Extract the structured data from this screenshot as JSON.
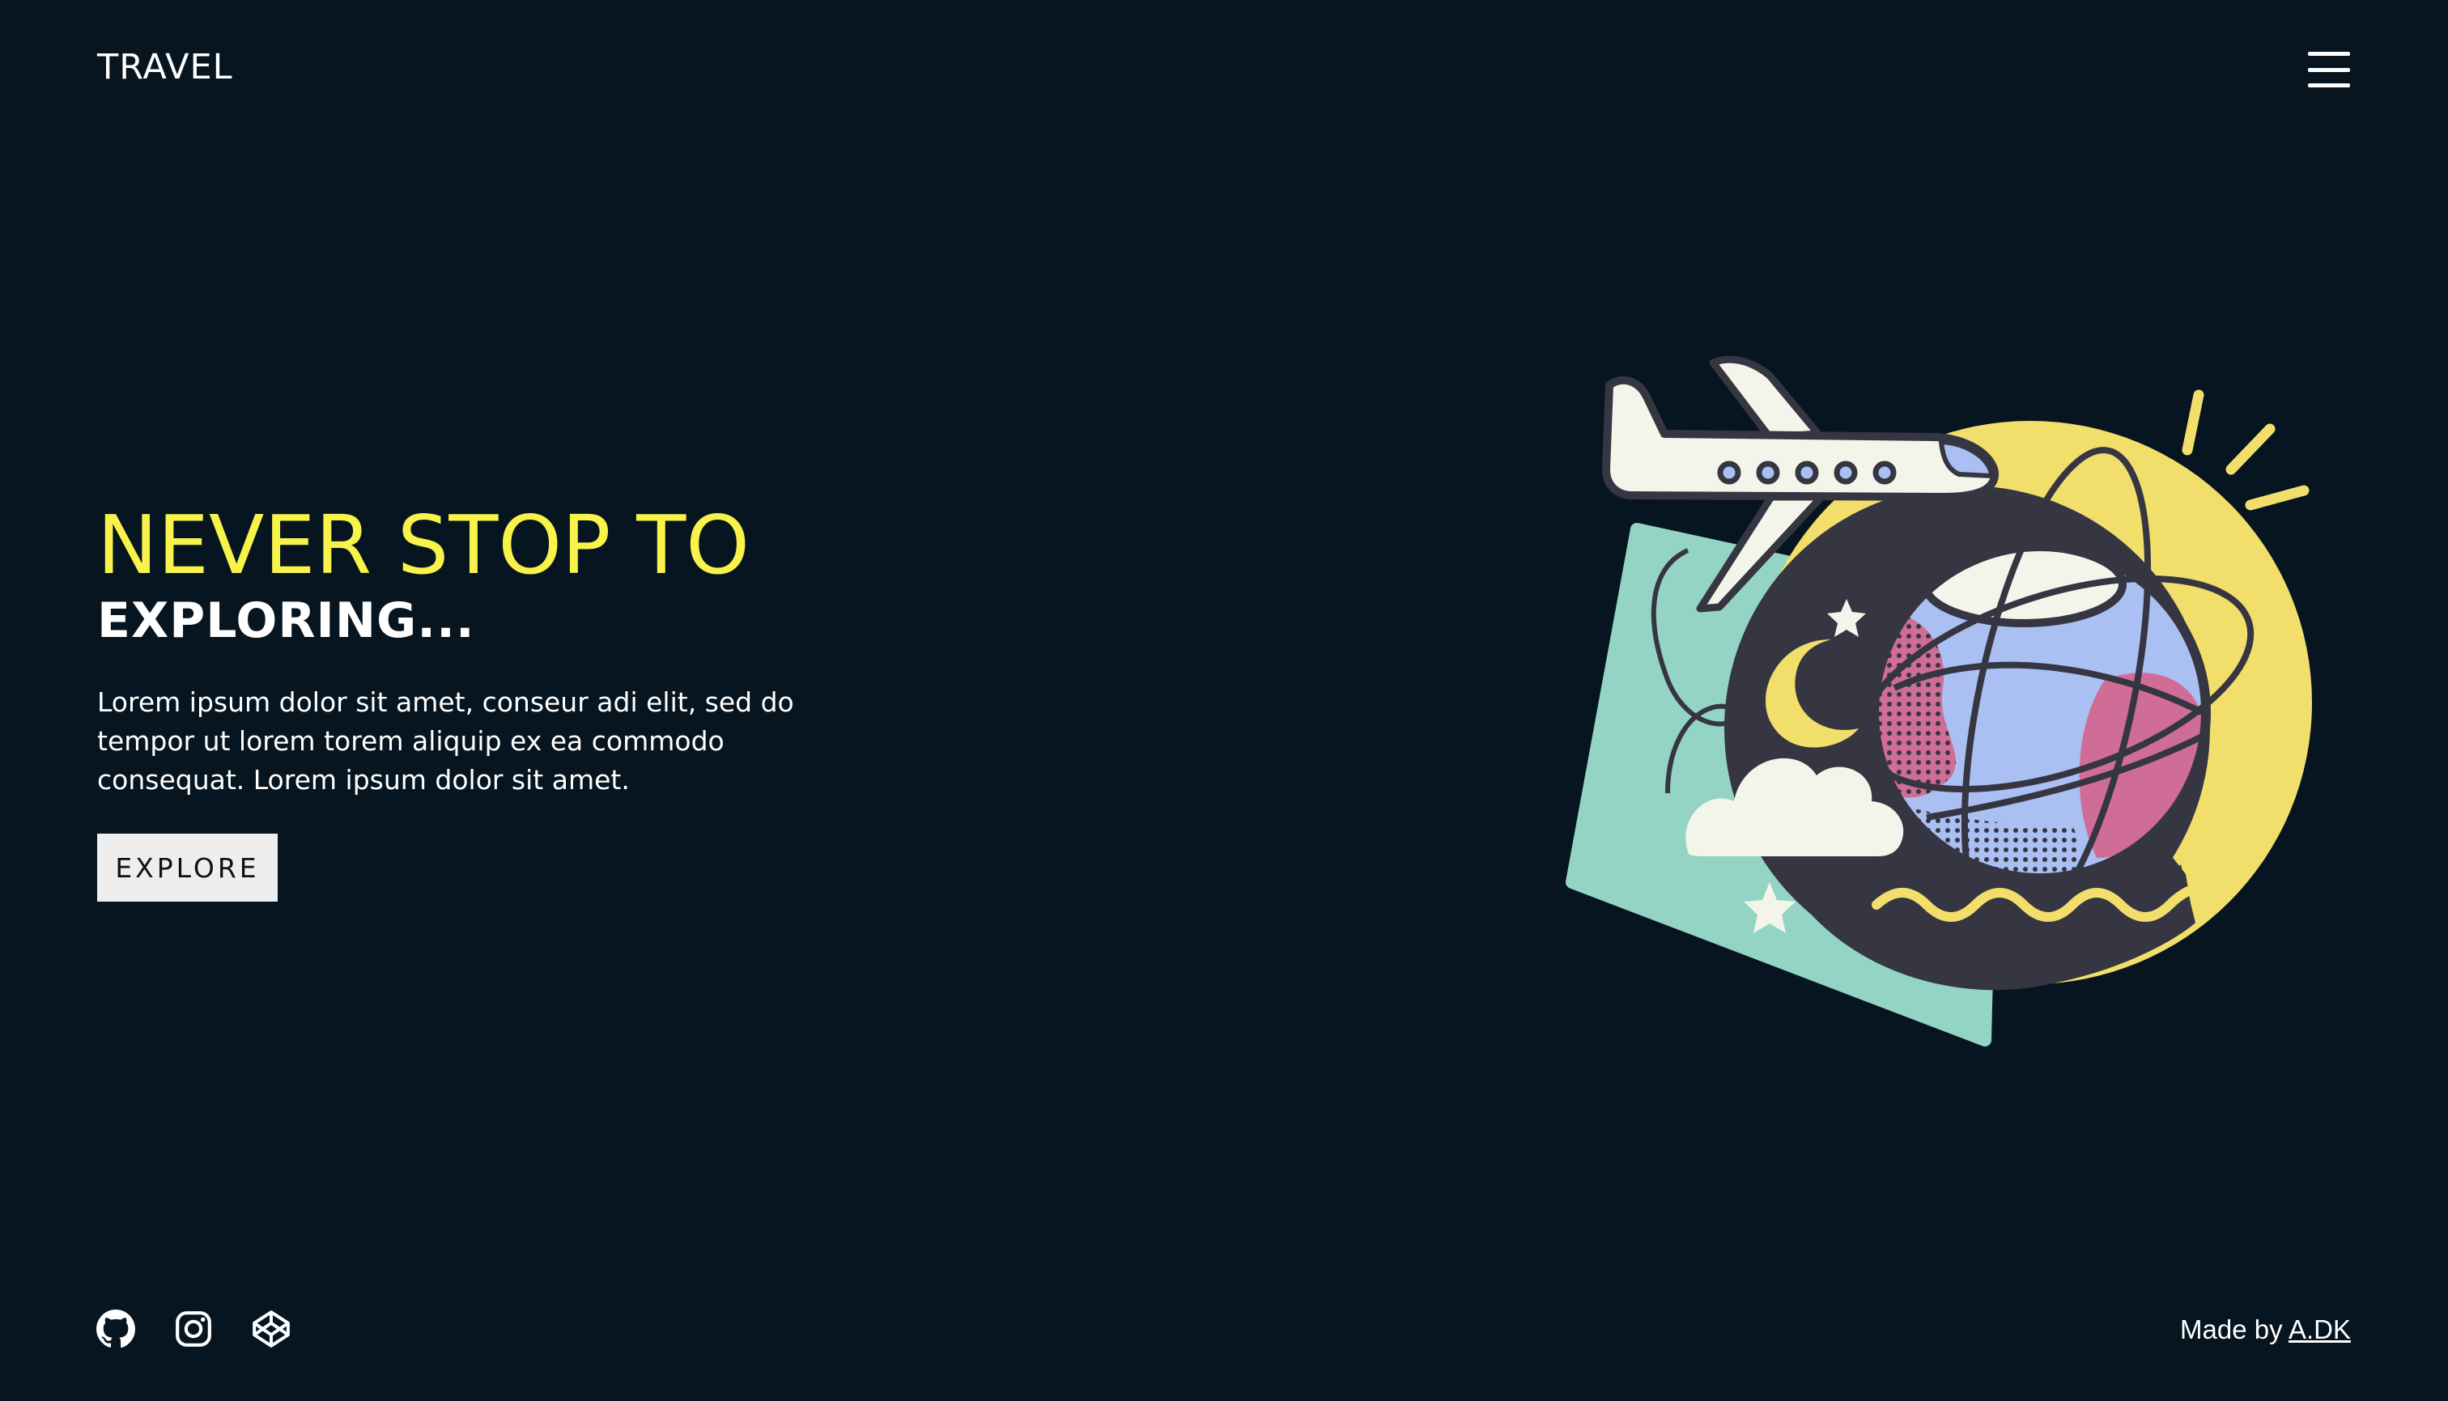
{
  "header": {
    "brand": "TRAVEL",
    "menu_icon": "hamburger-menu-icon"
  },
  "hero": {
    "headline": "NEVER STOP TO",
    "subheadline": "EXPLORING...",
    "description": "Lorem ipsum dolor sit amet, conseur adi elit, sed do tempor ut lorem torem aliquip ex ea commodo consequat. Lorem ipsum dolor sit amet.",
    "cta_label": "EXPLORE"
  },
  "illustration": {
    "name": "travel-globe-illustration",
    "elements": [
      "airplane",
      "globe",
      "moon",
      "stars",
      "cloud",
      "sun-rays",
      "wave"
    ]
  },
  "footer": {
    "social_icons": [
      "github-icon",
      "instagram-icon",
      "codepen-icon"
    ],
    "credit_prefix": "Made by ",
    "credit_link": "A.DK"
  },
  "colors": {
    "background": "#061520",
    "accent_yellow": "#f7f34a",
    "button_bg": "#eeeeee",
    "illustration_mint": "#93d4c4",
    "illustration_sun": "#f2de6a",
    "illustration_dark": "#363643",
    "illustration_blue": "#aabff2",
    "illustration_pink": "#d06d96",
    "illustration_cream": "#f4f5ea"
  }
}
